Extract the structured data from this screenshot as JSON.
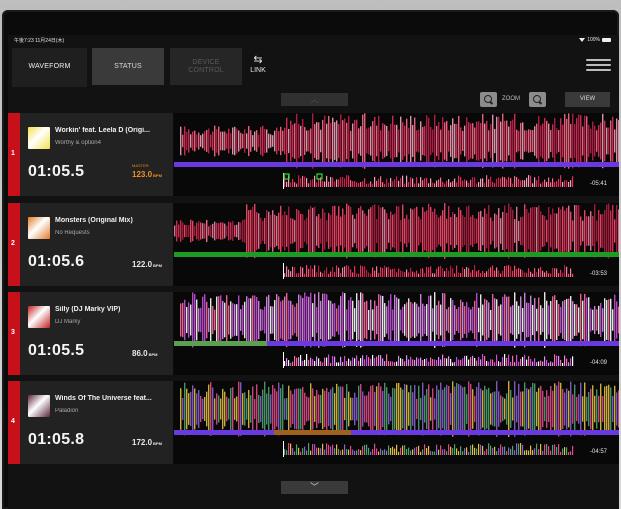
{
  "statusbar": {
    "time": "午後7:23  11月24日(木)",
    "battery": "100%"
  },
  "tabs": {
    "waveform": "WAVEFORM",
    "status": "STATUS",
    "device_control": "DEVICE\nCONTROL",
    "link": "LINK"
  },
  "toolbar": {
    "zoom_label": "ZOOM",
    "view_label": "VIEW"
  },
  "colors": {
    "deck_number_bg": "#c8101a",
    "master_accent": "#f09020",
    "waveform_pink": "#e0305a",
    "beatgrid_purple": "#7a3ae0",
    "green_bar": "#1d9b22"
  },
  "decks": [
    {
      "number": "1",
      "title": "Workin' feat. Leela D (Origi...",
      "artist": "Worthy & option4",
      "time": "01:05.5",
      "master_label": "MASTER",
      "bpm": "123.0",
      "bpm_unit": "BPM",
      "remaining": "-05:41",
      "art_color": "#f2e04a"
    },
    {
      "number": "2",
      "title": "Monsters (Original Mix)",
      "artist": "No Requests",
      "time": "01:05.6",
      "master_label": "",
      "bpm": "122.0",
      "bpm_unit": "BPM",
      "remaining": "-03:53",
      "art_color": "#e07a2a"
    },
    {
      "number": "3",
      "title": "Silly (DJ Marky VIP)",
      "artist": "DJ Marky",
      "time": "01:05.5",
      "master_label": "",
      "bpm": "86.0",
      "bpm_unit": "BPM",
      "remaining": "-04:09",
      "art_color": "#c02020"
    },
    {
      "number": "4",
      "title": "Winds Of The Universe feat...",
      "artist": "Paladion",
      "time": "01:05.8",
      "master_label": "",
      "bpm": "172.0",
      "bpm_unit": "BPM",
      "remaining": "-04:57",
      "art_color": "#5a2440"
    }
  ]
}
